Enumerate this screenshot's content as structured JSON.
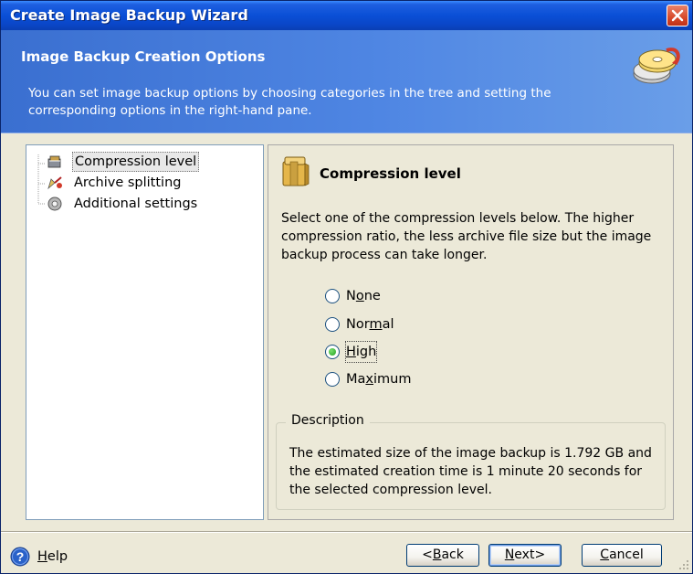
{
  "window": {
    "title": "Create Image Backup Wizard",
    "accent_color": "#0a4fd6"
  },
  "header": {
    "title": "Image Backup Creation Options",
    "description": "You can set image backup options by choosing categories in the tree and setting the corresponding options in the right-hand pane.",
    "art_icon": "backup-discs-icon"
  },
  "tree": {
    "items": [
      {
        "label": "Compression level",
        "icon": "compression-icon",
        "selected": true
      },
      {
        "label": "Archive splitting",
        "icon": "splitting-icon",
        "selected": false
      },
      {
        "label": "Additional settings",
        "icon": "settings-icon",
        "selected": false
      }
    ]
  },
  "section": {
    "title": "Compression level",
    "icon": "compression-box-icon",
    "description": "Select one of the compression levels below. The higher compression ratio, the less archive file size but the image backup process can take longer.",
    "options": [
      {
        "pre": "N",
        "access": "o",
        "post": "ne",
        "checked": false
      },
      {
        "pre": "Nor",
        "access": "m",
        "post": "al",
        "checked": false
      },
      {
        "pre": "",
        "access": "H",
        "post": "igh",
        "checked": true
      },
      {
        "pre": "Ma",
        "access": "x",
        "post": "imum",
        "checked": false
      }
    ]
  },
  "description_group": {
    "legend": "Description",
    "text": "The estimated size of the image backup is 1.792 GB and the estimated creation time is 1 minute 20 seconds for the selected compression level."
  },
  "footer": {
    "help": {
      "access": "H",
      "post": "elp"
    },
    "back": {
      "pre": "<",
      "access": "B",
      "post": "ack"
    },
    "next": {
      "pre": "",
      "access": "N",
      "post": "ext>"
    },
    "cancel": {
      "pre": "",
      "access": "C",
      "post": "ancel"
    }
  }
}
